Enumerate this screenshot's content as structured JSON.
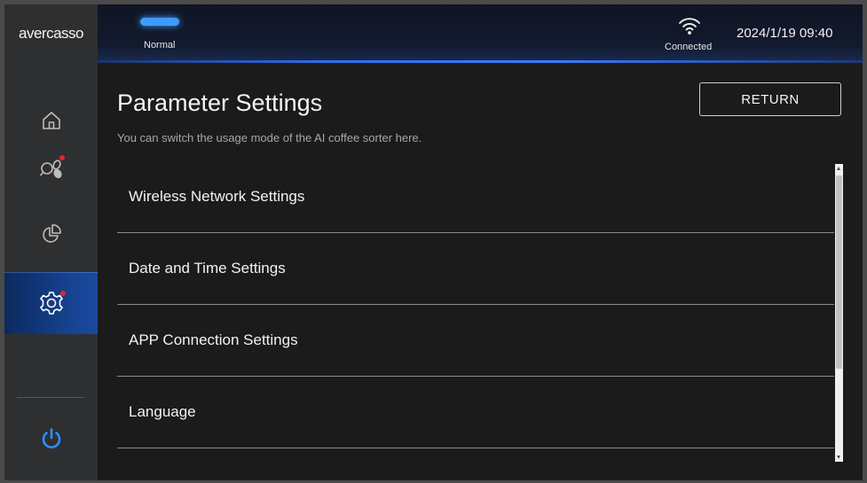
{
  "brand": {
    "logo": "avercasso"
  },
  "status": {
    "mode": "Normal",
    "connection": "Connected",
    "datetime": "2024/1/19 09:40"
  },
  "sidebar": {
    "items": [
      {
        "icon": "home-icon",
        "active": false
      },
      {
        "icon": "sorter-icon",
        "active": false,
        "notification": true
      },
      {
        "icon": "chart-icon",
        "active": false
      },
      {
        "icon": "gear-icon",
        "active": true,
        "notification": true
      },
      {
        "icon": "power-icon",
        "active": false
      }
    ]
  },
  "page": {
    "title": "Parameter Settings",
    "subtitle": "You can switch the usage mode of the AI coffee sorter here.",
    "return_label": "RETURN"
  },
  "settings": [
    "Wireless Network Settings",
    "Date and Time Settings",
    "APP Connection Settings",
    "Language"
  ],
  "colors": {
    "accent": "#3e9bff",
    "notification": "#e8222a",
    "active_nav": "#153f8a"
  }
}
